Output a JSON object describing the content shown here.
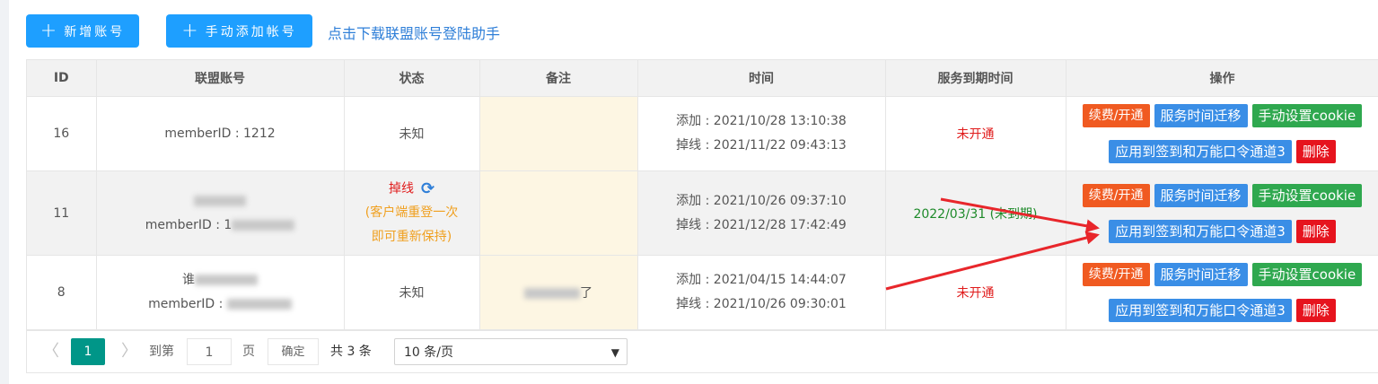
{
  "toolbar": {
    "new_account_label": "新增账号",
    "manual_add_label": "手动添加帐号",
    "plus_glyph": "+",
    "helper_link": "点击下载联盟账号登陆助手"
  },
  "table": {
    "headers": [
      "ID",
      "联盟账号",
      "状态",
      "备注",
      "时间",
      "服务到期时间",
      "操作"
    ],
    "rows": [
      {
        "id": "16",
        "account_line1": "memberID : 1212",
        "status": "未知",
        "added": "添加 : 2021/10/28 13:10:38",
        "offline": "掉线 : 2021/11/22 09:43:13",
        "expiry": "未开通"
      },
      {
        "id": "11",
        "account_line2": "memberID : 1",
        "status": "掉线",
        "status_hint1": "(客户端重登一次",
        "status_hint2": "即可重新保持)",
        "added": "添加 : 2021/10/26 09:37:10",
        "offline": "掉线 : 2021/12/28 17:42:49",
        "expiry": "2022/03/31 (未到期)"
      },
      {
        "id": "8",
        "account_line1_prefix": "谁",
        "account_line2": "memberID : ",
        "status": "未知",
        "note": "了",
        "added": "添加 : 2021/04/15 14:44:07",
        "offline": "掉线 : 2021/10/26 09:30:01",
        "expiry": "未开通"
      }
    ],
    "actions": {
      "renew": "续费/开通",
      "migrate": "服务时间迁移",
      "cookie": "手动设置cookie",
      "apply": "应用到签到和万能口令通道3",
      "delete": "删除"
    }
  },
  "pager": {
    "prev": "〈",
    "current": "1",
    "next": "〉",
    "goto": "到第",
    "input_value": "1",
    "page": "页",
    "confirm": "确定",
    "total": "共 3 条",
    "per_page": "10 条/页"
  },
  "colors": {
    "primary": "#1e9fff",
    "pager_active": "#009688",
    "renew": "#f05a21",
    "cookie": "#2fa84f",
    "delete": "#e6141e",
    "arrow": "#e8262b"
  },
  "icons": [
    "plus-icon",
    "refresh-icon",
    "chevron-left-icon",
    "chevron-right-icon",
    "caret-down-icon",
    "arrow-annotation"
  ]
}
